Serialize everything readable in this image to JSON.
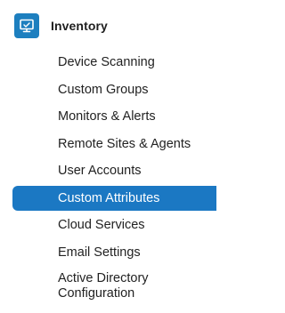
{
  "section": {
    "title": "Inventory",
    "icon": "monitor-icon",
    "icon_color": "#1d7fbf"
  },
  "colors": {
    "active_background": "#1b78c3",
    "active_text": "#ffffff",
    "text": "#222222"
  },
  "menu": {
    "items": [
      {
        "label": "Device Scanning"
      },
      {
        "label": "Custom Groups"
      },
      {
        "label": "Monitors & Alerts"
      },
      {
        "label": "Remote Sites & Agents"
      },
      {
        "label": "User Accounts"
      },
      {
        "label": "Custom Attributes",
        "active": true
      },
      {
        "label": "Cloud Services"
      },
      {
        "label": "Email Settings"
      },
      {
        "label_line1": "Active Directory",
        "label_line2": "Configuration"
      }
    ]
  }
}
